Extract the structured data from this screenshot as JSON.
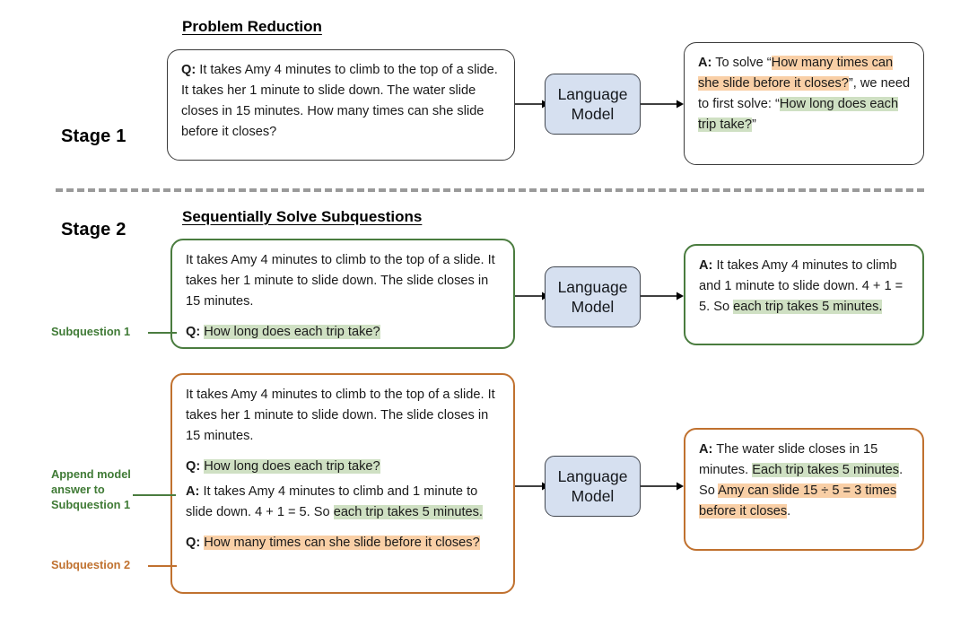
{
  "colors": {
    "highlight_green": "#cfe0c3",
    "highlight_orange": "#f9cfa6",
    "border_green": "#4a7c3f",
    "border_orange": "#c0712f",
    "lm_fill": "#d6e0f0",
    "lm_border": "#41464f",
    "divider": "#9a9a9a"
  },
  "stage1": {
    "stage_label": "Stage 1",
    "heading": "Problem Reduction",
    "prompt": {
      "tag": "Q:",
      "text": " It takes Amy 4 minutes to climb to the top of a slide. It takes her 1 minute to slide down. The water slide closes in 15 minutes. How many times can she slide before it closes?"
    },
    "model": {
      "line1": "Language",
      "line2": "Model"
    },
    "answer": {
      "tag": "A:",
      "seg1": " To solve “",
      "seg2_orange": "How many times can she slide before it closes?",
      "seg3": "”, we need to first solve: “",
      "seg4_green": "How long does each trip take?",
      "seg5": "”"
    }
  },
  "stage2": {
    "stage_label": "Stage 2",
    "heading": "Sequentially Solve Subquestions",
    "round1": {
      "side_label": "Subquestion 1",
      "context": "It takes Amy 4 minutes to climb to the top of a slide. It takes her 1 minute to slide down. The slide closes in 15 minutes.",
      "question_tag": "Q:",
      "question_green": "How long does each trip take?",
      "model": {
        "line1": "Language",
        "line2": "Model"
      },
      "answer": {
        "tag": "A:",
        "seg1": " It takes Amy 4 minutes to climb and 1 minute to slide down. 4 + 1 = 5. So ",
        "seg2_green": "each trip takes 5 minutes."
      }
    },
    "round2": {
      "side_label_append": "Append model\nanswer to\nSubquestion 1",
      "side_label_sub2": "Subquestion 2",
      "context": "It takes Amy 4 minutes to climb to the top of a slide. It takes her 1 minute to slide down. The slide closes in 15 minutes.",
      "q1_tag": "Q:",
      "q1_green": "How long does each trip take?",
      "a1_tag": "A:",
      "a1_seg1": " It takes Amy 4 minutes to climb and 1 minute to slide down. 4 + 1 = 5. So ",
      "a1_seg2_green": "each trip takes 5 minutes.",
      "q2_tag": "Q:",
      "q2_orange": "How many times can she slide before it closes?",
      "model": {
        "line1": "Language",
        "line2": "Model"
      },
      "answer": {
        "tag": "A:",
        "seg1": " The water slide closes in 15 minutes. ",
        "seg2_green": "Each trip takes 5 minutes",
        "seg3": ". So ",
        "seg4_orange": "Amy can slide 15 ÷ 5 = 3 times before it closes",
        "seg5": "."
      }
    }
  }
}
